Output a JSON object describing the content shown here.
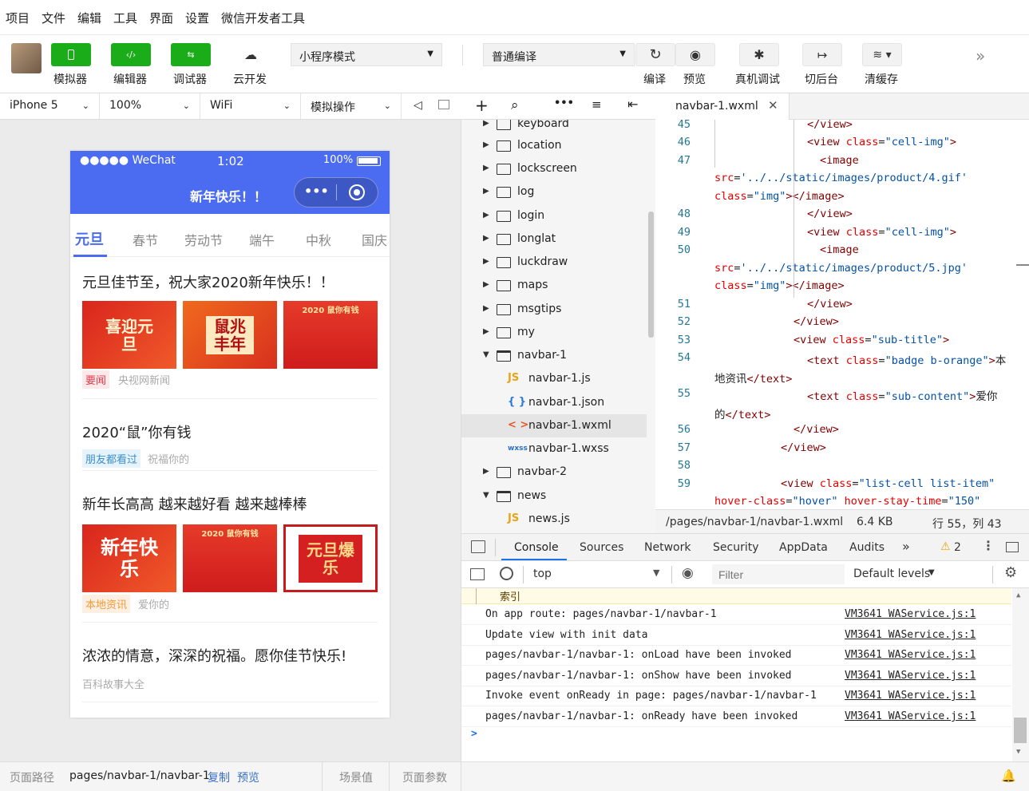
{
  "menu": [
    "项目",
    "文件",
    "编辑",
    "工具",
    "界面",
    "设置",
    "微信开发者工具"
  ],
  "toolbar": {
    "simulator": "模拟器",
    "editor": "编辑器",
    "debugger": "调试器",
    "cloud": "云开发",
    "mode_select": "小程序模式",
    "compile_select": "普通编译",
    "compile": "编译",
    "preview": "预览",
    "real_debug": "真机调试",
    "background": "切后台",
    "clear_cache": "清缓存"
  },
  "device": {
    "model": "iPhone 5",
    "zoom": "100%",
    "network": "WiFi",
    "operation": "模拟操作"
  },
  "phone": {
    "status_left": "●●●●● WeChat",
    "time": "1:02",
    "battery": "100%",
    "nav_title": "新年快乐！！",
    "tabs": [
      "元旦",
      "春节",
      "劳动节",
      "端午",
      "中秋",
      "国庆"
    ],
    "news": [
      {
        "title": "元旦佳节至，祝大家2020新年快乐！！",
        "tag": "要闻",
        "source": "央视网新闻",
        "imgs": [
          "喜迎元旦",
          "鼠兆丰年",
          "2020 鼠你有钱"
        ]
      },
      {
        "title": "2020“鼠”你有钱",
        "tag": "朋友都看过",
        "source": "祝福你的"
      },
      {
        "title": "新年长高高 越来越好看 越来越棒棒",
        "tag": "本地资讯",
        "source": "爱你的",
        "imgs": [
          "新年快乐",
          "2020 鼠你有钱",
          "元旦爆乐"
        ]
      },
      {
        "title": "浓浓的情意，深深的祝福。愿你佳节快乐!",
        "source": "百科故事大全"
      }
    ]
  },
  "statusbar": {
    "path_label": "页面路径",
    "path": "pages/navbar-1/navbar-1",
    "copy": "复制",
    "preview": "预览",
    "scene": "场景值",
    "params": "页面参数"
  },
  "tree": {
    "items": [
      {
        "name": "keyboard",
        "type": "folder"
      },
      {
        "name": "location",
        "type": "folder"
      },
      {
        "name": "lockscreen",
        "type": "folder"
      },
      {
        "name": "log",
        "type": "folder"
      },
      {
        "name": "login",
        "type": "folder"
      },
      {
        "name": "longlat",
        "type": "folder"
      },
      {
        "name": "luckdraw",
        "type": "folder"
      },
      {
        "name": "maps",
        "type": "folder"
      },
      {
        "name": "msgtips",
        "type": "folder"
      },
      {
        "name": "my",
        "type": "folder"
      },
      {
        "name": "navbar-1",
        "type": "open"
      },
      {
        "name": "navbar-1.js",
        "type": "js",
        "icon": "JS"
      },
      {
        "name": "navbar-1.json",
        "type": "json",
        "icon": "{ }"
      },
      {
        "name": "navbar-1.wxml",
        "type": "wxml",
        "icon": "< >"
      },
      {
        "name": "navbar-1.wxss",
        "type": "wxss",
        "icon": "wxss"
      },
      {
        "name": "navbar-2",
        "type": "folder"
      },
      {
        "name": "news",
        "type": "open"
      },
      {
        "name": "news.js",
        "type": "js",
        "icon": "JS"
      }
    ]
  },
  "editor": {
    "tab": "navbar-1.wxml",
    "file_path": "/pages/navbar-1/navbar-1.wxml",
    "size": "6.4 KB",
    "cursor": "行 55，列 43",
    "line_numbers": [
      "45",
      "46",
      "47",
      "48",
      "49",
      "50",
      "51",
      "52",
      "53",
      "54",
      "55",
      "56",
      "57",
      "58",
      "59"
    ]
  },
  "console": {
    "tabs": [
      "Console",
      "Sources",
      "Network",
      "Security",
      "AppData",
      "Audits"
    ],
    "warn_count": "2",
    "context": "top",
    "filter_placeholder": "Filter",
    "levels": "Default levels",
    "partial": "索引",
    "logs": [
      {
        "msg": "On app route: pages/navbar-1/navbar-1",
        "src": "VM3641 WAService.js:1"
      },
      {
        "msg": "Update view with init data",
        "src": "VM3641 WAService.js:1"
      },
      {
        "msg": "pages/navbar-1/navbar-1: onLoad have been invoked",
        "src": "VM3641 WAService.js:1"
      },
      {
        "msg": "pages/navbar-1/navbar-1: onShow have been invoked",
        "src": "VM3641 WAService.js:1"
      },
      {
        "msg": "Invoke event onReady in page: pages/navbar-1/navbar-1",
        "src": "VM3641 WAService.js:1"
      },
      {
        "msg": "pages/navbar-1/navbar-1: onReady have been invoked",
        "src": "VM3641 WAService.js:1"
      }
    ],
    "prompt": ">"
  }
}
